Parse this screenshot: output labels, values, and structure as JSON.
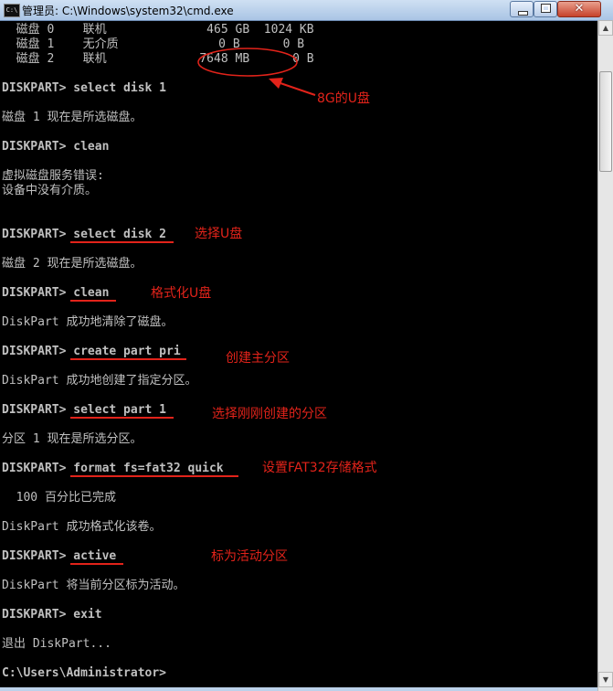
{
  "window": {
    "title": "管理员: C:\\Windows\\system32\\cmd.exe",
    "icon_text": "C:\\",
    "buttons": {
      "minimize": "minimize-icon",
      "maximize": "maximize-icon",
      "close_glyph": "✕"
    }
  },
  "console": {
    "lines": [
      "  磁盘 0    联机              465 GB  1024 KB",
      "  磁盘 1    无介质              0 B      0 B",
      "  磁盘 2    联机             7648 MB      0 B",
      "DISKPART> select disk 1",
      "磁盘 1 现在是所选磁盘。",
      "DISKPART> clean",
      "虚拟磁盘服务错误:",
      "设备中没有介质。",
      "DISKPART> select disk 2",
      "磁盘 2 现在是所选磁盘。",
      "DISKPART> clean",
      "DiskPart 成功地清除了磁盘。",
      "DISKPART> create part pri",
      "DiskPart 成功地创建了指定分区。",
      "DISKPART> select part 1",
      "分区 1 现在是所选分区。",
      "DISKPART> format fs=fat32 quick",
      "  100 百分比已完成",
      "DiskPart 成功格式化该卷。",
      "DISKPART> active",
      "DiskPart 将当前分区标为活动。",
      "DISKPART> exit",
      "退出 DiskPart...",
      "C:\\Users\\Administrator>"
    ]
  },
  "annotations": {
    "usb_8g": "8G的U盘",
    "select_usb": "选择U盘",
    "format_usb": "格式化U盘",
    "create_primary": "创建主分区",
    "select_partition": "选择刚刚创建的分区",
    "set_fat32": "设置FAT32存储格式",
    "mark_active": "标为活动分区"
  },
  "colors": {
    "annotation": "#e2231a",
    "console_text": "#c0c0c0",
    "console_bg": "#000000"
  }
}
